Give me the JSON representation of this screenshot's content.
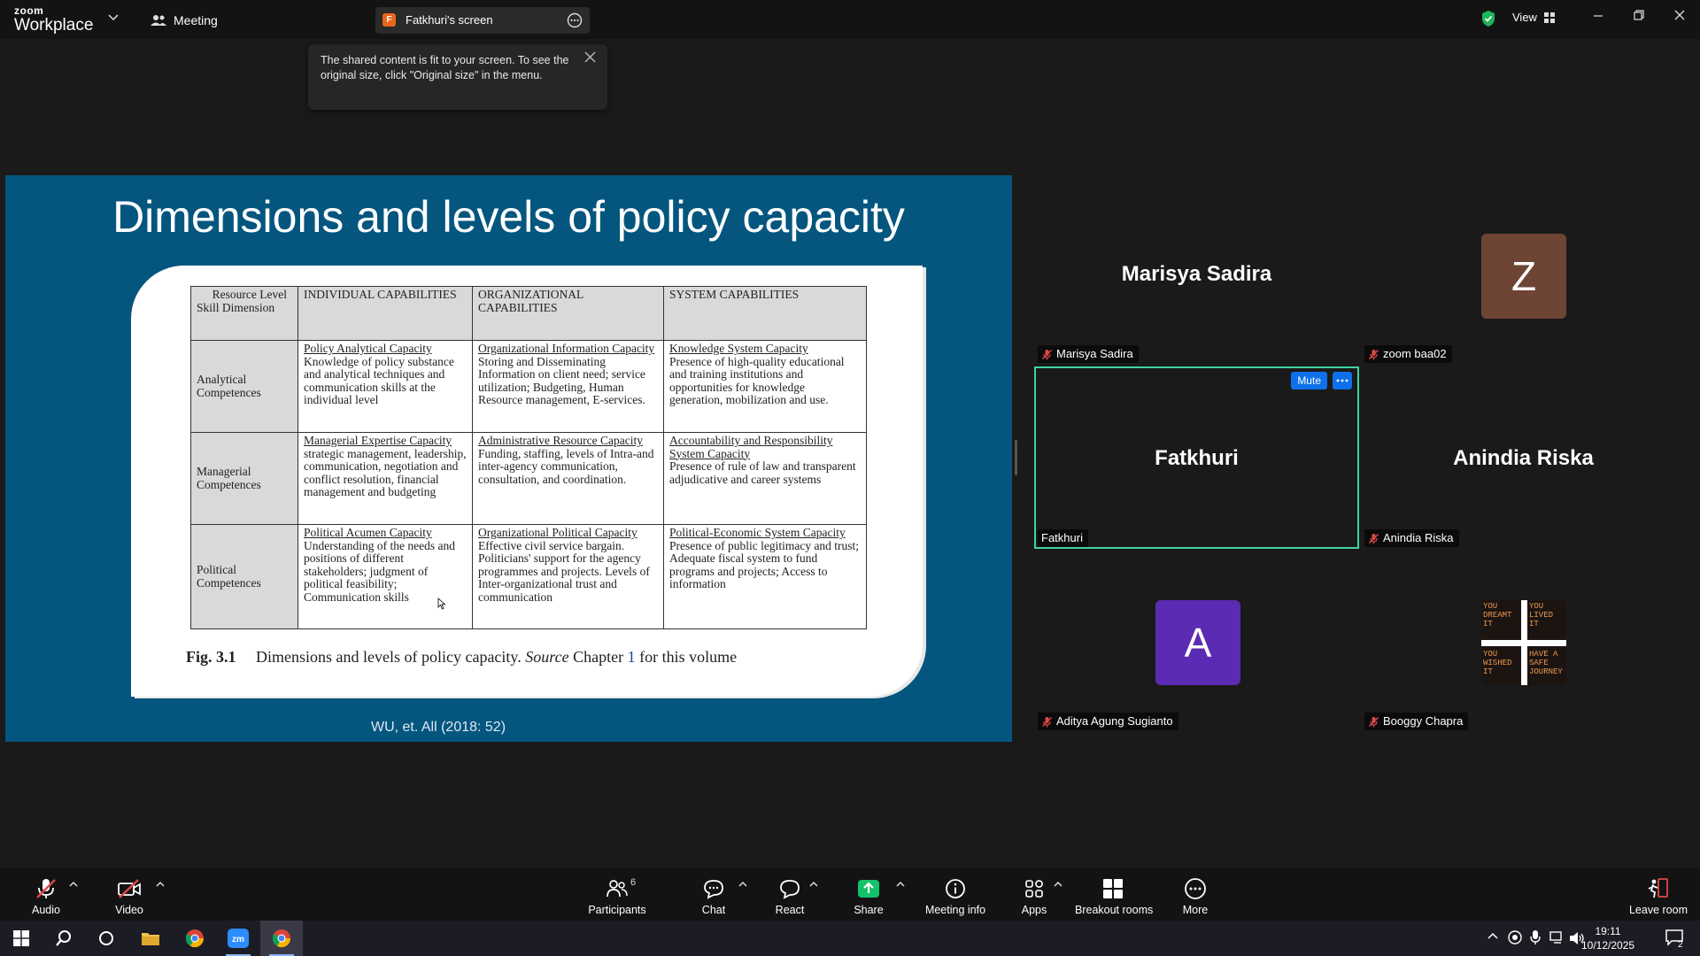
{
  "app": {
    "logo_line1": "zoom",
    "logo_line2": "Workplace",
    "meeting_label": "Meeting",
    "share_tab_badge": "F",
    "share_tab_title": "Fatkhuri's screen",
    "view_label": "View"
  },
  "tooltip": {
    "text": "The shared content is fit to your screen. To see the original size, click \"Original size\" in the menu."
  },
  "slide": {
    "title": "Dimensions and levels of policy capacity",
    "footer": "WU, et. All (2018: 52)",
    "table": {
      "corner_resource": "Resource Level",
      "corner_skill": "Skill Dimension",
      "headers": [
        "INDIVIDUAL CAPABILITIES",
        "ORGANIZATIONAL CAPABILITIES",
        "SYSTEM CAPABILITIES"
      ],
      "rows": [
        {
          "label": "Analytical Competences",
          "cells": [
            {
              "title": "Policy Analytical Capacity",
              "body": "Knowledge of policy substance and analytical techniques and communication skills at the individual level"
            },
            {
              "title": "Organizational Information Capacity",
              "body": "Storing and Disseminating Information on client need; service utilization; Budgeting, Human Resource management, E-services."
            },
            {
              "title": "Knowledge System Capacity",
              "body": "Presence of high-quality educational and training institutions and opportunities for knowledge generation, mobilization and use."
            }
          ]
        },
        {
          "label": "Managerial Competences",
          "cells": [
            {
              "title": "Managerial Expertise Capacity",
              "body": "strategic management, leadership, communication, negotiation and conflict resolution, financial management and budgeting"
            },
            {
              "title": "Administrative Resource Capacity",
              "body": "Funding, staffing, levels of Intra-and inter-agency communication, consultation, and coordination."
            },
            {
              "title": "Accountability and Responsibility System Capacity",
              "body": "Presence of rule of law and transparent adjudicative and career systems"
            }
          ]
        },
        {
          "label": "Political Competences",
          "cells": [
            {
              "title": "Political Acumen Capacity",
              "body": "Understanding of the needs and positions of different stakeholders; judgment of political feasibility; Communication skills"
            },
            {
              "title": "Organizational Political Capacity",
              "body": "Effective civil service bargain. Politicians' support for the agency programmes and projects. Levels of Inter-organizational trust and communication"
            },
            {
              "title": "Political-Economic System Capacity",
              "body": "Presence of public legitimacy and trust; Adequate fiscal system to fund programs and projects; Access to information"
            }
          ]
        }
      ],
      "caption_label": "Fig. 3.1",
      "caption_text": "Dimensions and levels of policy capacity.",
      "caption_source": "Source",
      "caption_chapter": "Chapter",
      "caption_num": "1",
      "caption_tail": "for this volume"
    }
  },
  "participants": [
    {
      "display": "Marisya Sadira",
      "label": "Marisya Sadira",
      "muted": true
    },
    {
      "display": "Z",
      "label": "zoom baa02",
      "muted": true,
      "avatar_color": "#6e4434"
    },
    {
      "display": "Fatkhuri",
      "label": "Fatkhuri",
      "muted": false,
      "active": true,
      "mute_btn": "Mute"
    },
    {
      "display": "Anindia Riska",
      "label": "Anindia Riska",
      "muted": true
    },
    {
      "display": "A",
      "label": "Aditya Agung Sugianto",
      "muted": true,
      "avatar_color": "#5b2bb3"
    },
    {
      "display": "",
      "label": "Booggy Chapra",
      "muted": true,
      "avatar_texts": [
        "YOU DREAMT IT",
        "YOU LIVED IT",
        "YOU WISHED IT",
        "HAVE A SAFE JOURNEY"
      ]
    }
  ],
  "toolbar": {
    "audio": "Audio",
    "video": "Video",
    "participants": "Participants",
    "participants_count": "6",
    "chat": "Chat",
    "react": "React",
    "share": "Share",
    "meeting_info": "Meeting info",
    "apps": "Apps",
    "breakout": "Breakout rooms",
    "more": "More",
    "leave": "Leave room"
  },
  "taskbar": {
    "time": "19:11",
    "date": "10/12/2025",
    "notif_count": "2"
  },
  "colors": {
    "slide_bg": "#04567f",
    "active_border": "#3fd3a0",
    "zoom_blue": "#0e71eb",
    "share_green": "#12c26a",
    "muted_red": "#e04848"
  }
}
